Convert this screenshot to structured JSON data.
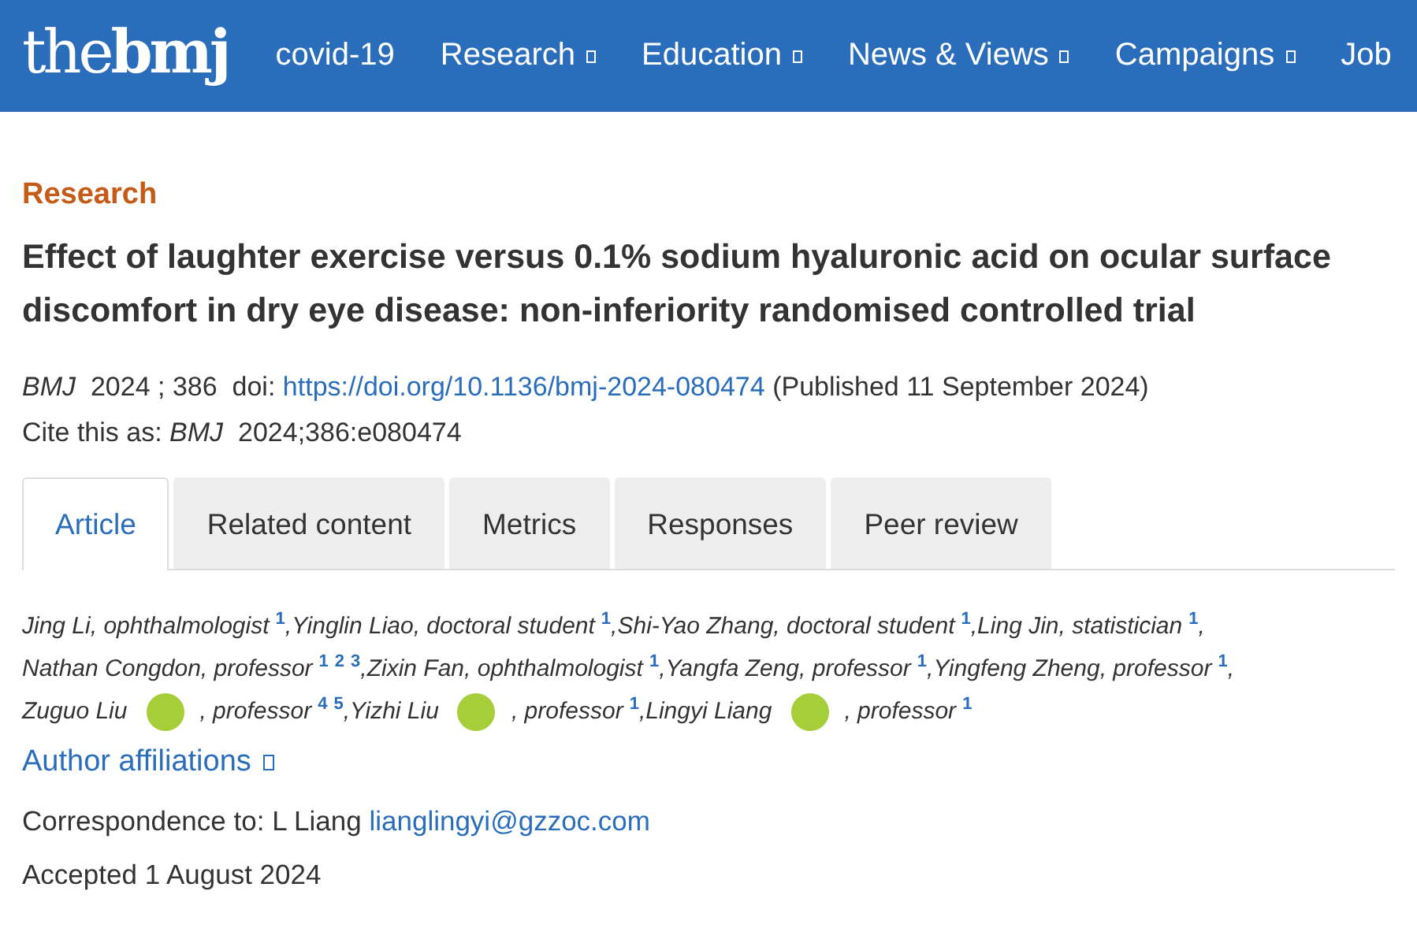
{
  "header": {
    "logo": {
      "light": "the",
      "bold": "bmj"
    },
    "nav": [
      {
        "label": "covid-19",
        "dropdown": false
      },
      {
        "label": "Research",
        "dropdown": true
      },
      {
        "label": "Education",
        "dropdown": true
      },
      {
        "label": "News & Views",
        "dropdown": true
      },
      {
        "label": "Campaigns",
        "dropdown": true
      },
      {
        "label": "Job",
        "dropdown": false
      }
    ]
  },
  "article": {
    "section": "Research",
    "title": "Effect of laughter exercise versus 0.1% sodium hyaluronic acid on ocular surface discomfort in dry eye disease: non-inferiority randomised controlled trial",
    "citation": {
      "journal": "BMJ",
      "year_volume": "2024 ; 386",
      "doi_label": "doi:",
      "doi": "https://doi.org/10.1136/bmj-2024-080474",
      "published": "(Published 11 September 2024)"
    },
    "cite_as": {
      "label": "Cite this as:",
      "journal": "BMJ",
      "ref": "2024;386:e080474"
    },
    "tabs": [
      {
        "label": "Article",
        "selected": true
      },
      {
        "label": "Related content",
        "selected": false
      },
      {
        "label": "Metrics",
        "selected": false
      },
      {
        "label": "Responses",
        "selected": false
      },
      {
        "label": "Peer review",
        "selected": false
      }
    ],
    "author_lines": [
      [
        {
          "text": "Jing Li, ophthalmologist",
          "orcid": false,
          "sup": [
            "1"
          ],
          "sep": ","
        },
        {
          "text": "Yinglin Liao, doctoral student",
          "orcid": false,
          "sup": [
            "1"
          ],
          "sep": ","
        },
        {
          "text": "Shi-Yao Zhang, doctoral student",
          "orcid": false,
          "sup": [
            "1"
          ],
          "sep": ","
        },
        {
          "text": "Ling Jin, statistician",
          "orcid": false,
          "sup": [
            "1"
          ],
          "sep": ","
        }
      ],
      [
        {
          "text": "Nathan Congdon, professor",
          "orcid": false,
          "sup": [
            "1",
            "2",
            "3"
          ],
          "sep": ","
        },
        {
          "text": "Zixin Fan, ophthalmologist",
          "orcid": false,
          "sup": [
            "1"
          ],
          "sep": ","
        },
        {
          "text": "Yangfa Zeng, professor",
          "orcid": false,
          "sup": [
            "1"
          ],
          "sep": ","
        },
        {
          "text": "Yingfeng Zheng, professor",
          "orcid": false,
          "sup": [
            "1"
          ],
          "sep": ","
        }
      ],
      [
        {
          "text": "Zuguo Liu",
          "orcid": true,
          "text_after": ", professor",
          "sup": [
            "4",
            "5"
          ],
          "sep": ","
        },
        {
          "text": "Yizhi Liu",
          "orcid": true,
          "text_after": ", professor",
          "sup": [
            "1"
          ],
          "sep": ","
        },
        {
          "text": "Lingyi Liang",
          "orcid": true,
          "text_after": ", professor",
          "sup": [
            "1"
          ]
        }
      ]
    ],
    "affiliations_link": "Author affiliations",
    "correspondence": {
      "label": "Correspondence to: L Liang",
      "email": "lianglingyi@gzzoc.com"
    },
    "accepted": "Accepted 1 August 2024"
  }
}
